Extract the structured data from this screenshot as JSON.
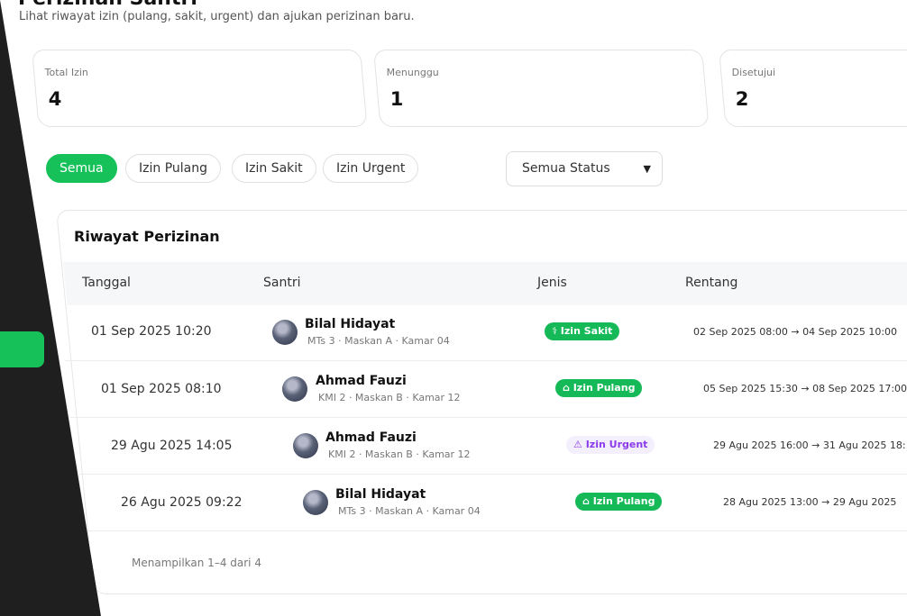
{
  "header": {
    "title": "Perizinan Santri",
    "subtitle": "Lihat riwayat izin (pulang, sakit, urgent) dan ajukan perizinan baru."
  },
  "stats": [
    {
      "label": "Total Izin",
      "value": "4"
    },
    {
      "label": "Menunggu",
      "value": "1"
    },
    {
      "label": "Disetujui",
      "value": "2"
    }
  ],
  "filters": {
    "chips": [
      "Semua",
      "Izin Pulang",
      "Izin Sakit",
      "Izin Urgent"
    ],
    "active": "Semua",
    "status_select": "Semua Status"
  },
  "table": {
    "title": "Riwayat Perizinan",
    "columns": [
      "Tanggal",
      "Santri",
      "Jenis",
      "Rentang"
    ],
    "rows": [
      {
        "date": "01 Sep 2025 10:20",
        "name": "Bilal Hidayat",
        "meta": "MTs 3 · Maskan A · Kamar 04",
        "type": "Izin Sakit",
        "type_icon": "stethoscope-icon",
        "range": "02 Sep 2025 08:00 → 04 Sep 2025 10:00"
      },
      {
        "date": "01 Sep 2025 08:10",
        "name": "Ahmad Fauzi",
        "meta": "KMI 2 · Maskan B · Kamar 12",
        "type": "Izin Pulang",
        "type_icon": "home-icon",
        "range": "05 Sep 2025 15:30 → 08 Sep 2025 17:00"
      },
      {
        "date": "29 Agu 2025 14:05",
        "name": "Ahmad Fauzi",
        "meta": "KMI 2 · Maskan B · Kamar 12",
        "type": "Izin Urgent",
        "type_icon": "warning-icon",
        "range": "29 Agu 2025 16:00 → 31 Agu 2025 18:"
      },
      {
        "date": "26 Agu 2025 09:22",
        "name": "Bilal Hidayat",
        "meta": "MTs 3 · Maskan A · Kamar 04",
        "type": "Izin Pulang",
        "type_icon": "home-icon",
        "range": "28 Agu 2025 13:00 → 29 Agu 2025"
      }
    ],
    "footer": "Menampilkan 1–4 dari 4"
  },
  "colors": {
    "accent": "#17c15a",
    "urgent": "#8b3bea",
    "sidebar": "#1f1f1f"
  }
}
